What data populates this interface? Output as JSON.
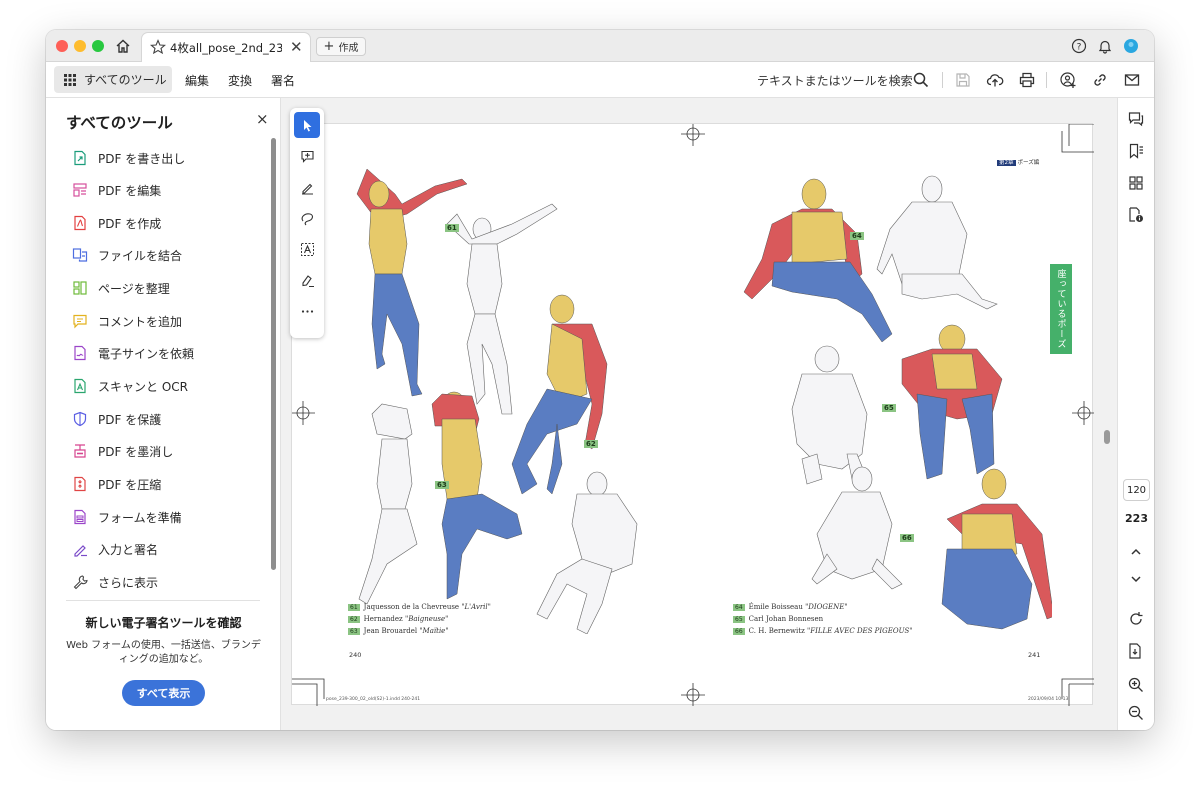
{
  "titlebar": {
    "tab_title": "4枚all_pose_2nd_230...",
    "tab_close": "✕",
    "create_label": "作成",
    "colors": {
      "close": "#fe5f57",
      "minimize": "#febc2e",
      "maximize": "#28c840",
      "accent": "#3b73d9"
    }
  },
  "menubar": {
    "all_tools": "すべてのツール",
    "items": [
      "編集",
      "変換",
      "署名"
    ],
    "search": "テキストまたはツールを検索"
  },
  "tools_panel": {
    "title": "すべてのツール",
    "close": "×",
    "items": [
      {
        "label": "PDF を書き出し",
        "icon": "export-pdf-icon",
        "color": "#1a9c7b"
      },
      {
        "label": "PDF を編集",
        "icon": "edit-pdf-icon",
        "color": "#d64f9c"
      },
      {
        "label": "PDF を作成",
        "icon": "create-pdf-icon",
        "color": "#e34040"
      },
      {
        "label": "ファイルを結合",
        "icon": "combine-files-icon",
        "color": "#4d6ee0"
      },
      {
        "label": "ページを整理",
        "icon": "organize-pages-icon",
        "color": "#6fba3a"
      },
      {
        "label": "コメントを追加",
        "icon": "comment-icon",
        "color": "#e3b21f"
      },
      {
        "label": "電子サインを依頼",
        "icon": "request-esign-icon",
        "color": "#9b45c9"
      },
      {
        "label": "スキャンと OCR",
        "icon": "scan-ocr-icon",
        "color": "#2aa56e"
      },
      {
        "label": "PDF を保護",
        "icon": "protect-pdf-icon",
        "color": "#5a5ee3"
      },
      {
        "label": "PDF を墨消し",
        "icon": "redact-pdf-icon",
        "color": "#d6458f"
      },
      {
        "label": "PDF を圧縮",
        "icon": "compress-pdf-icon",
        "color": "#e04545"
      },
      {
        "label": "フォームを準備",
        "icon": "prepare-form-icon",
        "color": "#9b45c9"
      },
      {
        "label": "入力と署名",
        "icon": "fill-sign-icon",
        "color": "#7a4ac9"
      },
      {
        "label": "さらに表示",
        "icon": "more-tools-icon",
        "color": "#444444"
      }
    ],
    "promo_title": "新しい電子署名ツールを確認",
    "promo_text": "Web フォームの使用、一括送信、ブランディングの追加など。",
    "promo_button": "すべて表示"
  },
  "document": {
    "left_page": {
      "figure_labels": [
        "61",
        "62",
        "63"
      ],
      "captions": [
        {
          "num": "61",
          "artist": "Jaquesson de la Chevreuse",
          "title": "\"L'Avril\""
        },
        {
          "num": "62",
          "artist": "Hernandez",
          "title": "\"Baigneuse\""
        },
        {
          "num": "63",
          "artist": "Jean Brouardel",
          "title": "\"Maïtie\""
        }
      ],
      "page_number": "240",
      "footer": "pose_239-300_02_old(S2)-1.indd   240-241"
    },
    "right_page": {
      "chapter_badge": "第2章",
      "chapter_title": "ポーズ編",
      "side_tab": "座っているポーズ",
      "figure_labels": [
        "64",
        "65",
        "66"
      ],
      "captions": [
        {
          "num": "64",
          "artist": "Émile Boisseau",
          "title": "\"DIOGENE\""
        },
        {
          "num": "65",
          "artist": "Carl Johan Bonnesen",
          "title": ""
        },
        {
          "num": "66",
          "artist": "C. H. Bernewitz",
          "title": "\"FILLE AVEC DES PIGEOUS\""
        }
      ],
      "page_number": "241",
      "footer": "2023/09/04   10:13"
    }
  },
  "right_rail": {
    "current_page": "120",
    "total_pages": "223"
  },
  "figure_colors": {
    "torso": "#e6c96a",
    "arms": "#d9595b",
    "legs": "#5a7dc2",
    "outline": "#e9e9ee"
  }
}
